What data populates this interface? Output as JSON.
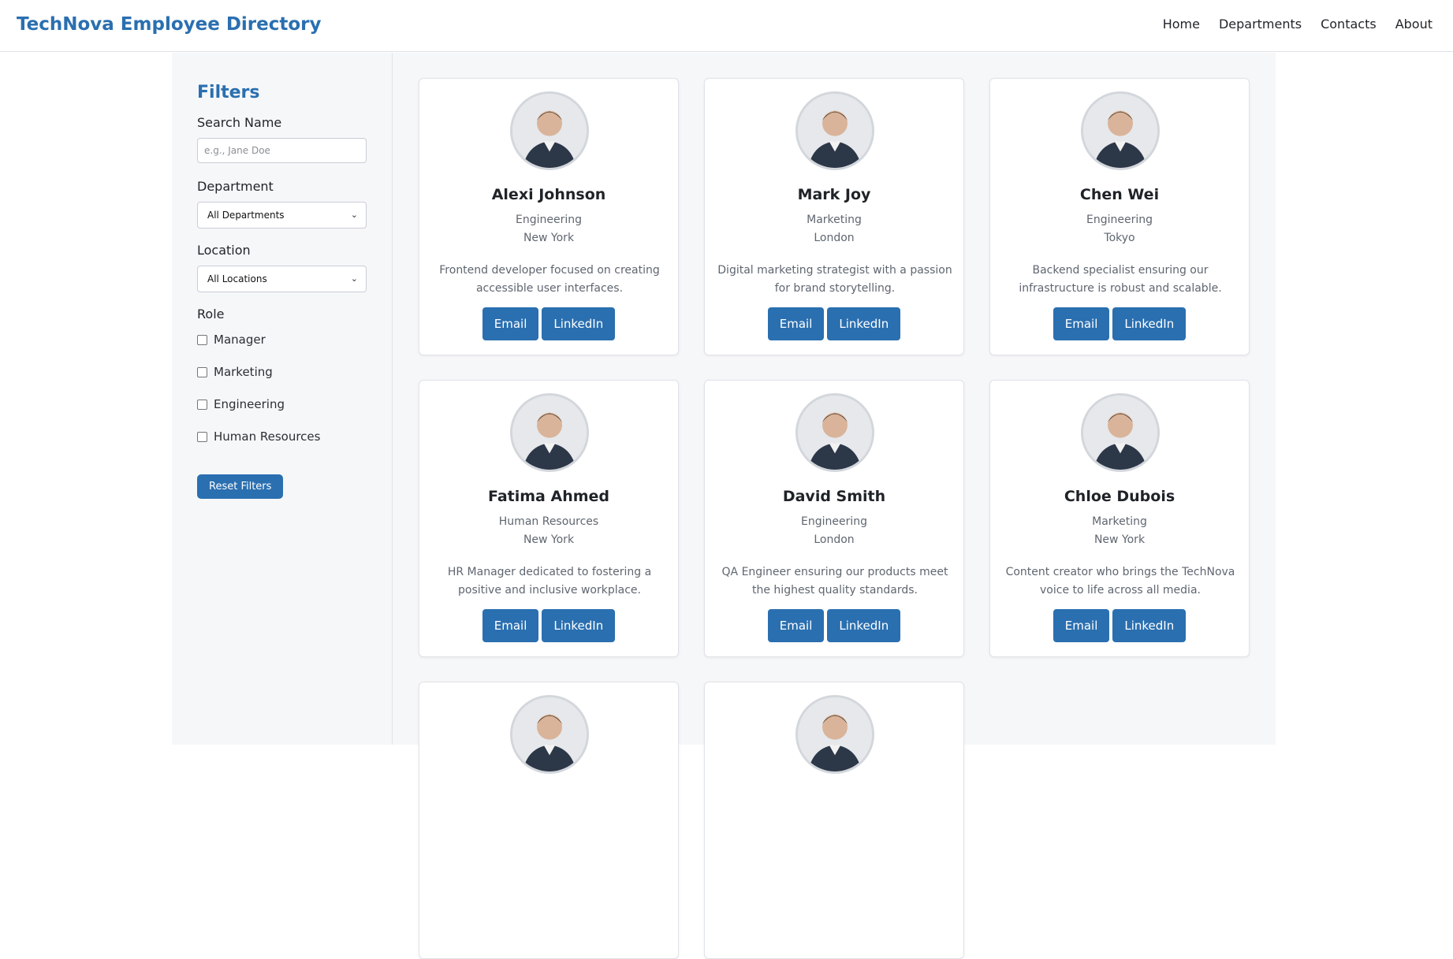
{
  "header": {
    "title": "TechNova Employee Directory",
    "nav": [
      "Home",
      "Departments",
      "Contacts",
      "About"
    ]
  },
  "filters": {
    "heading": "Filters",
    "search_label": "Search Name",
    "search_placeholder": "e.g., Jane Doe",
    "department_label": "Department",
    "department_value": "All Departments",
    "location_label": "Location",
    "location_value": "All Locations",
    "role_label": "Role",
    "roles": [
      "Manager",
      "Marketing",
      "Engineering",
      "Human Resources"
    ],
    "reset_label": "Reset Filters"
  },
  "buttons": {
    "email": "Email",
    "linkedin": "LinkedIn"
  },
  "employees": [
    {
      "name": "Alexi Johnson",
      "department": "Engineering",
      "location": "New York",
      "bio": "Frontend developer focused on creating accessible user interfaces."
    },
    {
      "name": "Mark Joy",
      "department": "Marketing",
      "location": "London",
      "bio": "Digital marketing strategist with a passion for brand storytelling."
    },
    {
      "name": "Chen Wei",
      "department": "Engineering",
      "location": "Tokyo",
      "bio": "Backend specialist ensuring our infrastructure is robust and scalable."
    },
    {
      "name": "Fatima Ahmed",
      "department": "Human Resources",
      "location": "New York",
      "bio": "HR Manager dedicated to fostering a positive and inclusive workplace."
    },
    {
      "name": "David Smith",
      "department": "Engineering",
      "location": "London",
      "bio": "QA Engineer ensuring our products meet the highest quality standards."
    },
    {
      "name": "Chloe Dubois",
      "department": "Marketing",
      "location": "New York",
      "bio": "Content creator who brings the TechNova voice to life across all media."
    },
    {
      "name": "",
      "department": "",
      "location": "",
      "bio": ""
    },
    {
      "name": "",
      "department": "",
      "location": "",
      "bio": ""
    }
  ],
  "colors": {
    "accent": "#2a6fb0",
    "panel": "#f6f7f9"
  },
  "icons": {
    "avatar": "person-photo-icon",
    "select": "chevron-down-icon"
  }
}
